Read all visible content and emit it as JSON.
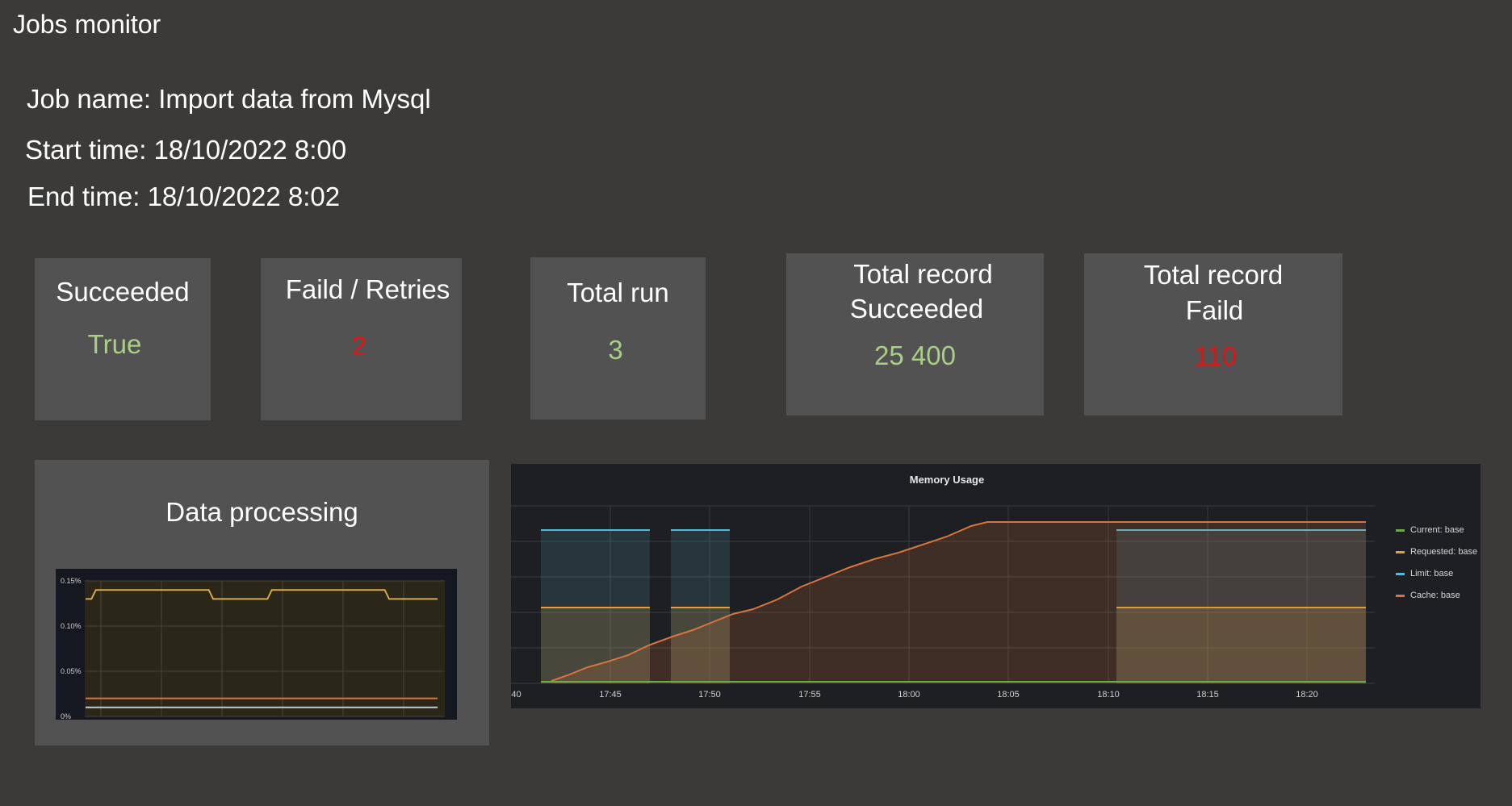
{
  "page": {
    "title": "Jobs monitor"
  },
  "job": {
    "name": "Job name: Import data from Mysql",
    "start": "Start time: 18/10/2022 8:00",
    "end": "End time: 18/10/2022 8:02"
  },
  "cards": {
    "succeeded": {
      "label": "Succeeded",
      "value": "True"
    },
    "failed_retries": {
      "label": "Faild / Retries",
      "value": "2"
    },
    "total_run": {
      "label": "Total run",
      "value": "3"
    },
    "records_succeeded": {
      "label_line1": "Total record",
      "label_line2": "Succeeded",
      "value": "25 400"
    },
    "records_failed": {
      "label_line1": "Total record",
      "label_line2": "Faild",
      "value": "110"
    }
  },
  "colors": {
    "good": "#a9cf84",
    "bad": "#e11414",
    "current": "#6fa84a",
    "requested": "#e0a33a",
    "limit": "#5cb8d8",
    "cache": "#d8743f"
  },
  "data_processing": {
    "title": "Data processing"
  },
  "chart_data": [
    {
      "type": "line",
      "title": "",
      "ylabel": "",
      "y_ticks": [
        "0%",
        "0.05%",
        "0.10%",
        "0.15%"
      ],
      "ylim": [
        0,
        0.15
      ],
      "grid": true,
      "series": [
        {
          "values": [
            0.13,
            0.14,
            0.14,
            0.14,
            0.14,
            0.13,
            0.13,
            0.14,
            0.14,
            0.14,
            0.14,
            0.13,
            0.13
          ]
        },
        {
          "values": [
            0.02,
            0.02,
            0.02,
            0.02,
            0.02,
            0.02,
            0.02,
            0.02,
            0.02,
            0.02,
            0.02,
            0.02,
            0.02
          ]
        },
        {
          "values": [
            0.01,
            0.01,
            0.01,
            0.01,
            0.01,
            0.01,
            0.01,
            0.01,
            0.01,
            0.01,
            0.01,
            0.01,
            0.01
          ]
        }
      ]
    },
    {
      "type": "area",
      "title": "Memory Usage",
      "x_ticks": [
        ":40",
        "17:45",
        "17:50",
        "17:55",
        "18:00",
        "18:05",
        "18:10",
        "18:15",
        "18:20"
      ],
      "legend_position": "right",
      "grid": true,
      "series": [
        {
          "name": "Current: base",
          "color": "#6fa84a"
        },
        {
          "name": "Requested: base",
          "color": "#e0a33a"
        },
        {
          "name": "Limit: base",
          "color": "#5cb8d8"
        },
        {
          "name": "Cache: base",
          "color": "#d8743f"
        }
      ]
    }
  ]
}
